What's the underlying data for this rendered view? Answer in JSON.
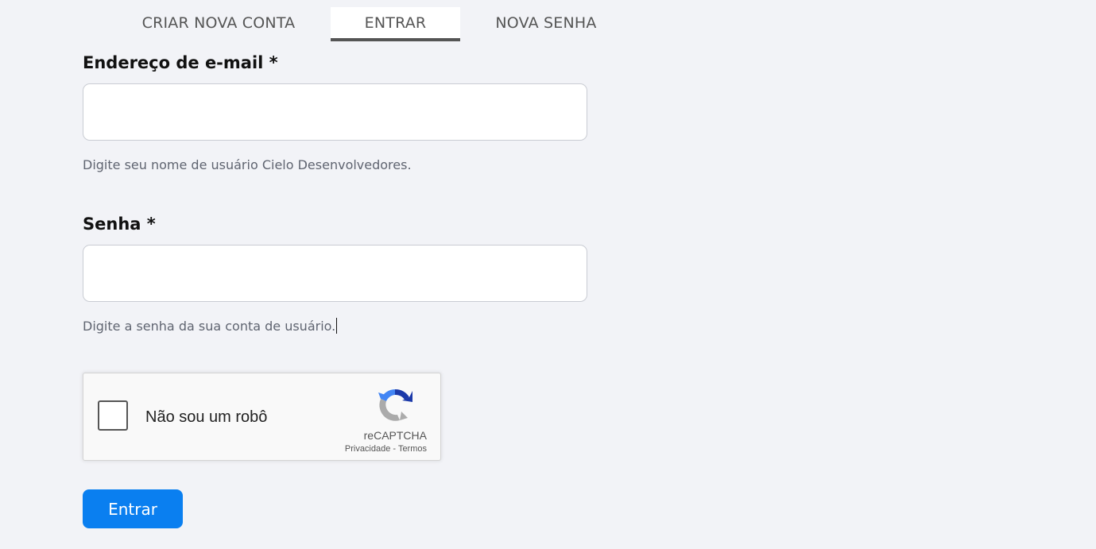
{
  "tabs": {
    "create_account": "CRIAR NOVA CONTA",
    "login": "ENTRAR",
    "new_password": "NOVA SENHA",
    "active": "ENTRAR"
  },
  "email": {
    "label": "Endereço de e-mail *",
    "value": "",
    "help": "Digite seu nome de usuário Cielo Desenvolvedores."
  },
  "password": {
    "label": "Senha *",
    "value": "",
    "help": "Digite a senha da sua conta de usuário."
  },
  "recaptcha": {
    "label": "Não sou um robô",
    "brand": "reCAPTCHA",
    "privacy": "Privacidade",
    "separator": " - ",
    "terms": "Termos",
    "icon": "recaptcha-icon"
  },
  "submit_label": "Entrar",
  "colors": {
    "background": "#f2f3f7",
    "primary": "#0a7ff0",
    "active_tab_border": "#555555"
  }
}
